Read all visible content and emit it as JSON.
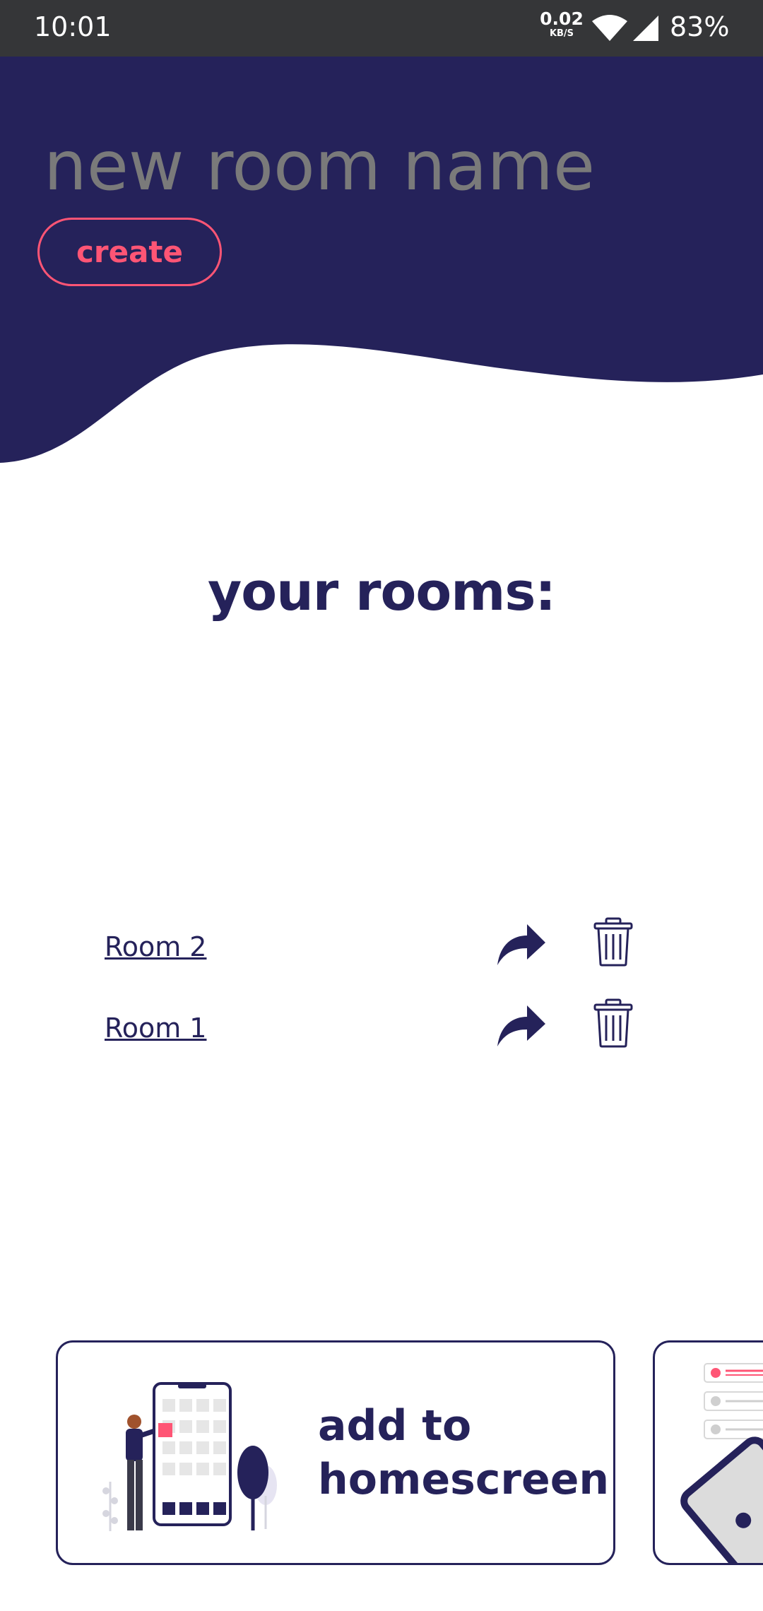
{
  "status_bar": {
    "time": "10:01",
    "network_speed": "0.02",
    "network_unit": "KB/S",
    "battery": "83%"
  },
  "header": {
    "room_name_placeholder": "new room name",
    "create_label": "create"
  },
  "rooms": {
    "title": "your rooms:",
    "items": [
      {
        "name": "Room 2"
      },
      {
        "name": "Room 1"
      }
    ]
  },
  "cards": {
    "add_to_homescreen_line1": "add to",
    "add_to_homescreen_line2": "homescreen"
  },
  "icons": {
    "share": "share-arrow-icon",
    "delete": "trash-icon",
    "wifi": "wifi-icon",
    "signal": "signal-icon"
  },
  "colors": {
    "primary": "#25225a",
    "accent": "#ff5575",
    "status_bar": "#353638",
    "placeholder": "#7a7a7a"
  }
}
